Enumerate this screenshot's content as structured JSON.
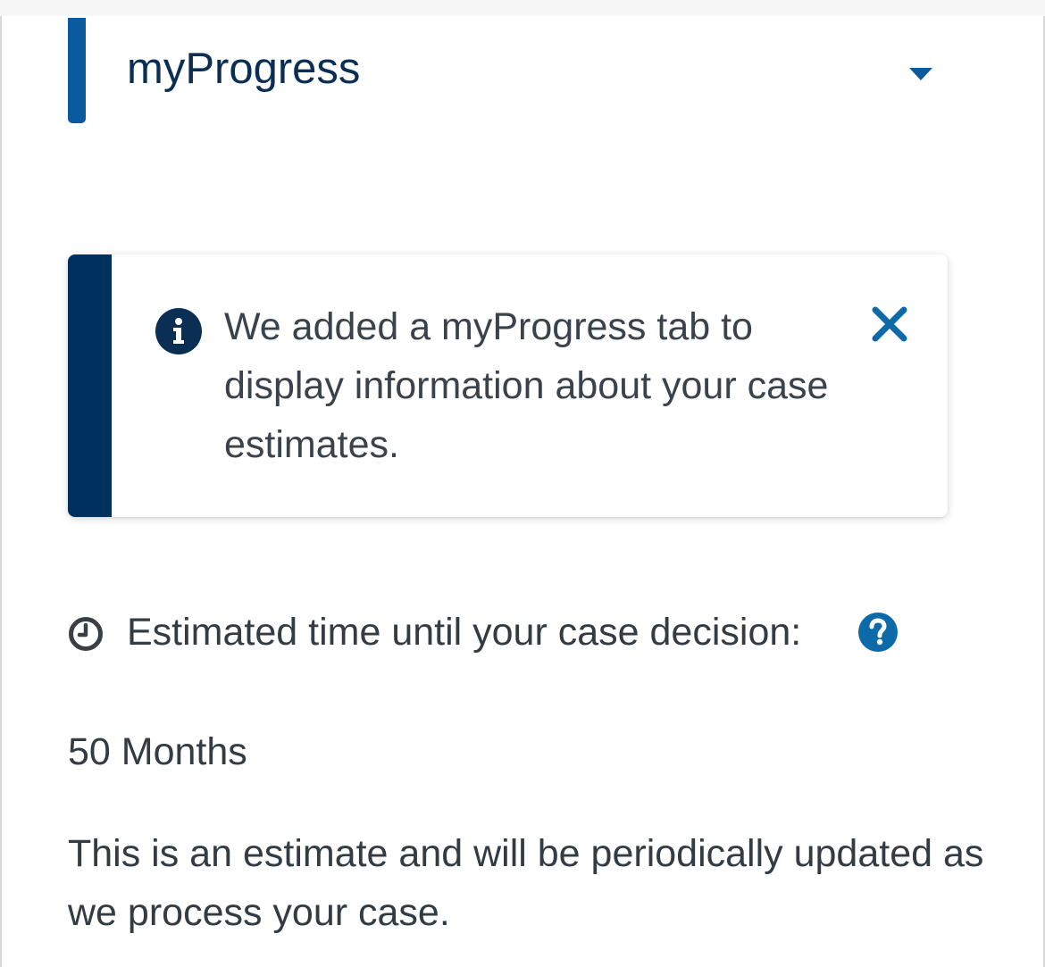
{
  "tab": {
    "title": "myProgress",
    "expand_icon": "chevron-down-icon"
  },
  "alert": {
    "icon": "info-icon",
    "message": "We added a myProgress tab to display information about your case estimates.",
    "close_icon": "close-icon"
  },
  "estimate": {
    "icon": "clock-icon",
    "label": "Estimated time until your case decision:",
    "help_icon": "help-icon",
    "value": "50 Months",
    "note": "This is an estimate and will be periodically updated as we process your case."
  },
  "colors": {
    "accent": "#0b5aa0",
    "navy": "#00305f",
    "title": "#0b2e55",
    "text": "#333b43",
    "help": "#0d6aa8"
  }
}
